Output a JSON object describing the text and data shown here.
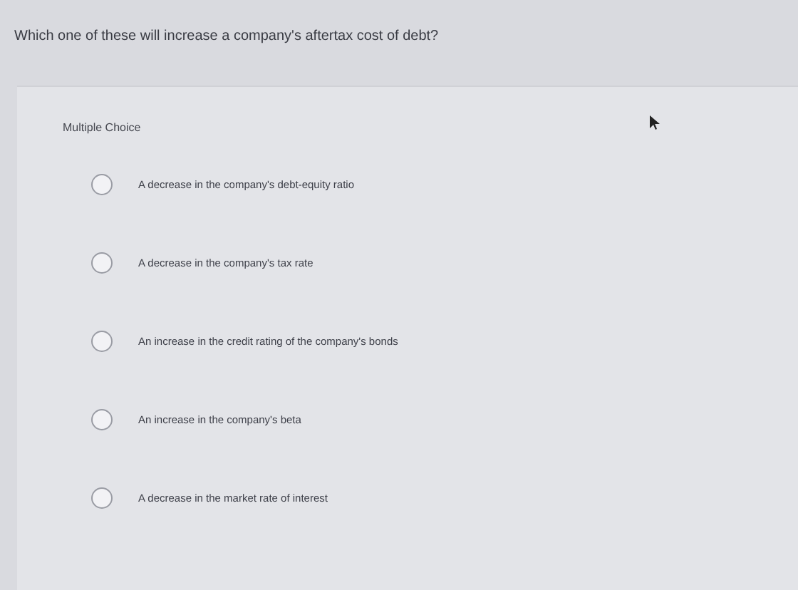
{
  "question": "Which one of these will increase a company's aftertax cost of debt?",
  "panel": {
    "label": "Multiple Choice"
  },
  "choices": [
    {
      "text": "A decrease in the company's debt-equity ratio",
      "selected": false
    },
    {
      "text": "A decrease in the company's tax rate",
      "selected": false
    },
    {
      "text": "An increase in the credit rating of the company's bonds",
      "selected": false
    },
    {
      "text": "An increase in the company's beta",
      "selected": false
    },
    {
      "text": "A decrease in the market rate of interest",
      "selected": false
    }
  ]
}
